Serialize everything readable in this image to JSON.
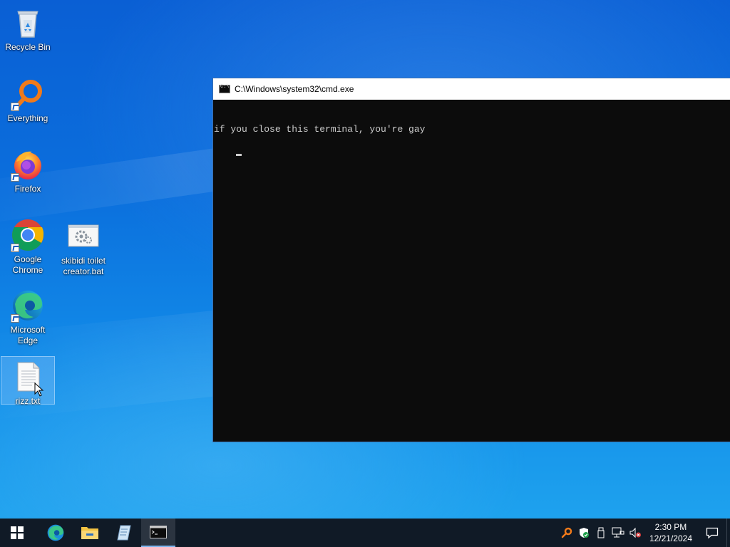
{
  "desktop": {
    "icons": [
      {
        "label": "Recycle Bin",
        "icon": "recycle-bin-icon"
      },
      {
        "label": "Everything",
        "icon": "everything-search-icon"
      },
      {
        "label": "Firefox",
        "icon": "firefox-icon"
      },
      {
        "label": "Google Chrome",
        "icon": "chrome-icon"
      },
      {
        "label": "skibidi toilet creator.bat",
        "icon": "batch-file-icon"
      },
      {
        "label": "Microsoft Edge",
        "icon": "edge-icon"
      },
      {
        "label": "rizz.txt",
        "icon": "text-file-icon",
        "selected": true
      }
    ]
  },
  "cmd_window": {
    "title": "C:\\Windows\\system32\\cmd.exe",
    "output": "if you close this terminal, you're gay"
  },
  "taskbar": {
    "items": [
      {
        "name": "start-button",
        "icon": "windows-logo-icon"
      },
      {
        "name": "edge",
        "icon": "edge-icon"
      },
      {
        "name": "file-explorer",
        "icon": "folder-icon"
      },
      {
        "name": "notepad",
        "icon": "notepad-icon"
      },
      {
        "name": "cmd",
        "icon": "cmd-icon",
        "active": true
      }
    ],
    "tray": {
      "icons": [
        "everything-tray-icon",
        "security-shield-icon",
        "usb-icon",
        "network-icon",
        "volume-muted-icon"
      ],
      "time": "2:30 PM",
      "date": "12/21/2024",
      "notification_icon": "notification-icon"
    }
  },
  "colors": {
    "taskbar_bg": "#101a26",
    "console_bg": "#0c0c0c",
    "console_fg": "#cccccc",
    "accent": "#7db5ee"
  }
}
